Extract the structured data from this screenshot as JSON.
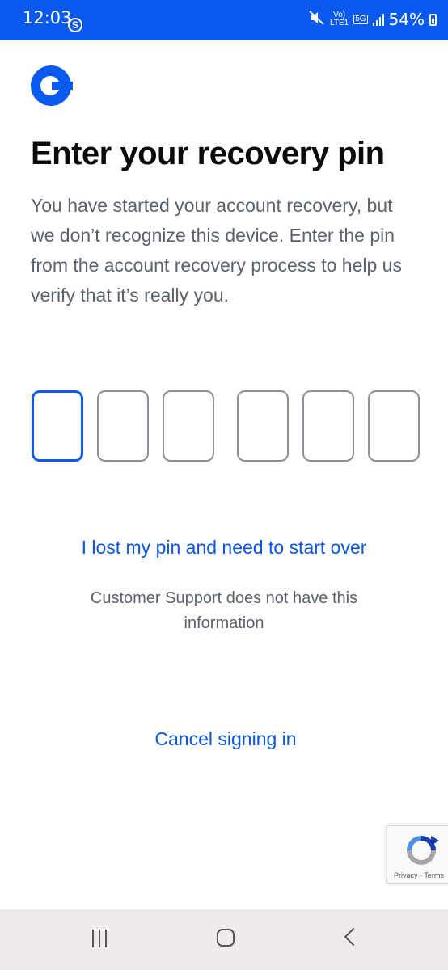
{
  "status_bar": {
    "time": "12:03",
    "app_badge": "S",
    "network_volte": "Vo)",
    "network_lte": "LTE1",
    "network_5g": "5G",
    "battery": "54%"
  },
  "logo": {
    "icon": "coinbase-logo-icon",
    "color": "#0a5af0"
  },
  "title": "Enter your recovery pin",
  "description": "You have started your account recovery, but we don’t recognize this device. Enter the pin from the account recovery process to help us verify that it’s really you.",
  "pin": {
    "digits": [
      "",
      "",
      "",
      "",
      "",
      ""
    ],
    "active_index": 0
  },
  "lost_pin_link": "I lost my pin and need to start over",
  "support_note": "Customer Support does not have this information",
  "cancel_link": "Cancel signing in",
  "recaptcha": {
    "terms": "Privacy - Terms"
  },
  "colors": {
    "accent": "#0a5af0",
    "status_bar": "#0a59ee",
    "text_primary": "#0a0b0d",
    "text_secondary": "#5b616e"
  }
}
